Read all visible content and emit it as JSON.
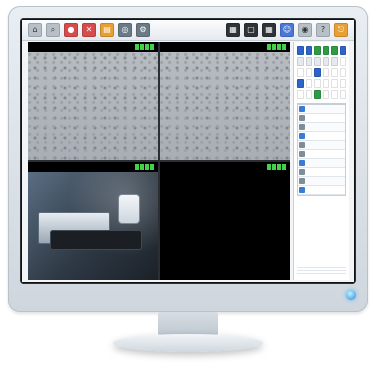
{
  "toolbar": {
    "left_icons": [
      "home-icon",
      "search-icon",
      "record-icon",
      "delete-icon",
      "folder-icon",
      "snapshot-icon",
      "settings-icon"
    ],
    "right_icons": [
      "layout-icon",
      "single-view-icon",
      "quad-view-icon",
      "user-icon",
      "network-icon",
      "help-icon",
      "exit-icon"
    ],
    "right_labels": [
      "",
      "",
      "",
      "",
      "",
      "",
      ""
    ]
  },
  "tiles": [
    {
      "title": "",
      "status": "",
      "timestamp": "",
      "signal": 4
    },
    {
      "title": "",
      "status": "",
      "timestamp": "",
      "signal": 4
    },
    {
      "title": "",
      "status": "",
      "timestamp": "",
      "signal": 4
    },
    {
      "title": "",
      "status": "",
      "timestamp": "",
      "signal": 4
    }
  ],
  "side_panel": {
    "section_label": "",
    "calendar_cells": [
      {
        "t": "",
        "c": "blue"
      },
      {
        "t": "",
        "c": "blue"
      },
      {
        "t": "",
        "c": "green"
      },
      {
        "t": "",
        "c": "green"
      },
      {
        "t": "",
        "c": "green"
      },
      {
        "t": "",
        "c": "blue"
      },
      {
        "t": "",
        "c": "gray"
      },
      {
        "t": "",
        "c": "gray"
      },
      {
        "t": "",
        "c": "gray"
      },
      {
        "t": "",
        "c": "gray"
      },
      {
        "t": "",
        "c": "gray"
      },
      {
        "t": "",
        "c": "white"
      },
      {
        "t": "",
        "c": "white"
      },
      {
        "t": "",
        "c": "white"
      },
      {
        "t": "",
        "c": "blue"
      },
      {
        "t": "",
        "c": "white"
      },
      {
        "t": "",
        "c": "white"
      },
      {
        "t": "",
        "c": "white"
      },
      {
        "t": "",
        "c": "blue"
      },
      {
        "t": "",
        "c": "white"
      },
      {
        "t": "",
        "c": "white"
      },
      {
        "t": "",
        "c": "white"
      },
      {
        "t": "",
        "c": "white"
      },
      {
        "t": "",
        "c": "white"
      },
      {
        "t": "",
        "c": "white"
      },
      {
        "t": "",
        "c": "white"
      },
      {
        "t": "",
        "c": "green"
      },
      {
        "t": "",
        "c": "white"
      },
      {
        "t": "",
        "c": "white"
      },
      {
        "t": "",
        "c": "white"
      }
    ],
    "table": {
      "headers": [
        "",
        "",
        "",
        ""
      ],
      "rows": [
        {
          "c0": "",
          "c1": "",
          "c2": "",
          "c3": ""
        },
        {
          "c0": "",
          "c1": "",
          "c2": "",
          "c3": ""
        },
        {
          "c0": "",
          "c1": "",
          "c2": "",
          "c3": ""
        },
        {
          "c0": "",
          "c1": "",
          "c2": "",
          "c3": ""
        },
        {
          "c0": "",
          "c1": "",
          "c2": "",
          "c3": ""
        },
        {
          "c0": "",
          "c1": "",
          "c2": "",
          "c3": ""
        },
        {
          "c0": "",
          "c1": "",
          "c2": "",
          "c3": ""
        },
        {
          "c0": "",
          "c1": "",
          "c2": "",
          "c3": ""
        },
        {
          "c0": "",
          "c1": "",
          "c2": "",
          "c3": ""
        },
        {
          "c0": "",
          "c1": "",
          "c2": "",
          "c3": ""
        }
      ]
    },
    "footer_lines": [
      "",
      "",
      ""
    ]
  }
}
